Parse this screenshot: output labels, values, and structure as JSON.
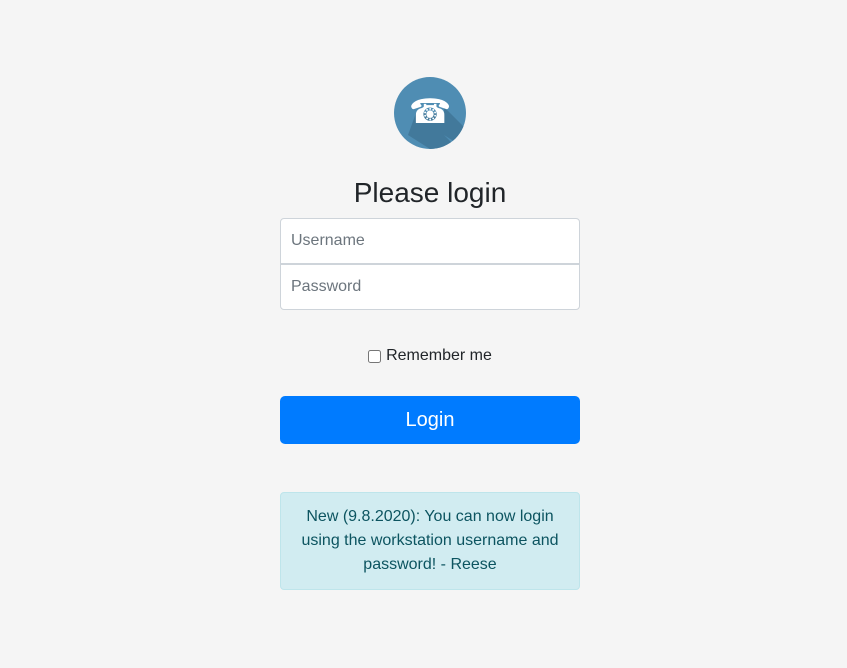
{
  "logo": {
    "icon": "telephone-logo-icon",
    "bg_color": "#4f8db3"
  },
  "form": {
    "title": "Please login",
    "username_placeholder": "Username",
    "password_placeholder": "Password",
    "remember_label": "Remember me",
    "remember_checked": false,
    "login_label": "Login"
  },
  "notice": {
    "text": "New (9.8.2020): You can now login using the workstation username and password! - Reese"
  },
  "colors": {
    "primary": "#007bff",
    "info_bg": "#d1ecf1",
    "info_text": "#0c5460"
  }
}
